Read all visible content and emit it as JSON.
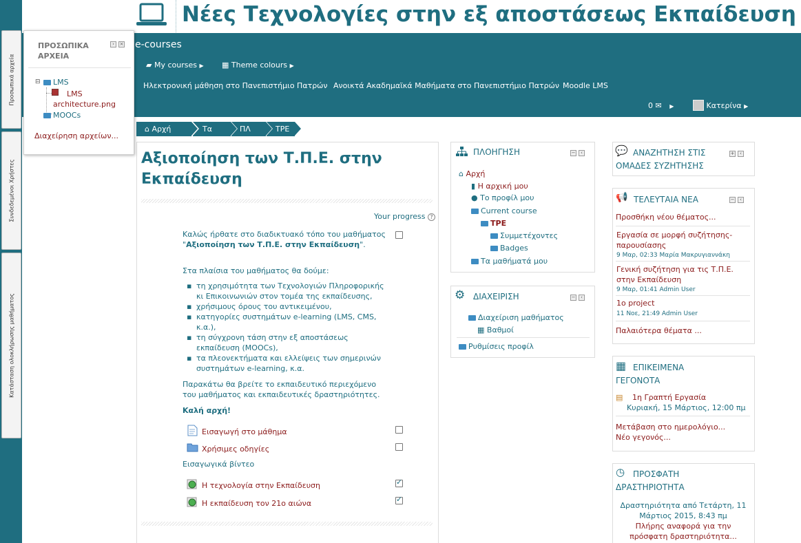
{
  "header": {
    "title": "Νέες Τεχνολογίες στην εξ αποστάσεως Εκπαίδευση",
    "brand": "e-courses",
    "my_courses": "My courses",
    "theme_colours": "Theme colours",
    "links": [
      "Ηλεκτρονική μάθηση στο Πανεπιστήμιο Πατρών",
      "Ανοικτά Ακαδημαϊκά Μαθήματα στο Πανεπιστήμιο Πατρών",
      "Moodle LMS"
    ],
    "messages_count": "0",
    "user_name": "Κατερίνα"
  },
  "dock": {
    "tabs": [
      "Προσωπικά αρχεία",
      "Συνδεδεμένοι Χρήστες",
      "Κατάσταση ολοκλήρωσης μαθήματος"
    ]
  },
  "private_files": {
    "title": "ΠΡΟΣΩΠΙΚΑ ΑΡΧΕΙΑ",
    "folder1": "LMS",
    "file1": "LMS architecture.png",
    "folder2": "MOOCs",
    "manage": "Διαχείρηση αρχείων..."
  },
  "breadcrumb": [
    "Αρχή",
    "Τα",
    "ΠΛ",
    "ΤΡΕ"
  ],
  "course": {
    "title": "Αξιοποίηση των Τ.Π.Ε. στην Εκπαίδευση",
    "your_progress": "Your progress",
    "intro_1": "Καλώς ήρθατε στο διαδικτυακό τόπο του μαθήματος \"",
    "intro_bold": "Αξιοποίηση των Τ.Π.Ε. στην Εκπαίδευση",
    "intro_2": "\".",
    "intro_list_title": "Στα πλαίσια του μαθήματος θα δούμε:",
    "topics": [
      "τη χρησιμότητα των Τεχνολογιών Πληροφορικής κι Επικοινωνιών στον τομέα της εκπαίδευσης,",
      "χρήσιμους όρους του αντικειμένου,",
      "κατηγορίες συστημάτων e-learning (LMS, CMS, κ.α.),",
      "τη σύγχρονη τάση στην εξ αποστάσεως εκπαίδευση (MOOCs),",
      "τα πλεονεκτήματα και ελλείψεις των σημερινών συστημάτων e-learning, κ.α."
    ],
    "outro": "Παρακάτω θα βρείτε το εκπαιδευτικό περιεχόμενο του μαθήματος και εκπαιδευτικές δραστηριότητες.",
    "good_start": "Καλή αρχή!",
    "activities": [
      {
        "label": "Εισαγωγή στο μάθημα",
        "done": false
      },
      {
        "label": "Χρήσιμες οδηγίες",
        "done": false
      }
    ],
    "videos_label": "Εισαγωγικά βίντεο",
    "videos": [
      {
        "label": "Η τεχνολογία στην Εκπαίδευση",
        "done": true
      },
      {
        "label": "Η εκπαίδευση τον 21ο αιώνα",
        "done": true
      }
    ]
  },
  "navigation": {
    "title": "ΠΛΟΗΓΗΣΗ",
    "home": "Αρχή",
    "my_home": "Η αρχική μου",
    "profile": "Το προφίλ μου",
    "current_course": "Current course",
    "tpe": "TPE",
    "participants": "Συμμετέχοντες",
    "badges": "Badges",
    "my_courses": "Τα μαθήματά μου"
  },
  "admin": {
    "title": "ΔΙΑΧΕΙΡΙΣΗ",
    "course_admin": "Διαχείριση μαθήματος",
    "grades": "Βαθμοί",
    "profile_settings": "Ρυθμίσεις προφίλ"
  },
  "forum_search": {
    "title": "ΑΝΑΖΗΤΗΣΗ ΣΤΙΣ ΟΜΑΔΕΣ ΣΥΖΗΤΗΣΗΣ"
  },
  "news": {
    "title": "ΤΕΛΕΥΤΑΙΑ ΝΕΑ",
    "add_topic": "Προσθήκη νέου θέματος...",
    "items": [
      {
        "title": "Εργασία σε μορφή συζήτησης-παρουσίασης",
        "meta": "9 Μαρ, 02:33 Μαρία Μακρυγιαννάκη"
      },
      {
        "title": "Γενική συζήτηση για τις Τ.Π.Ε. στην Εκπαίδευση",
        "meta": "9 Μαρ, 01:41 Admin User"
      },
      {
        "title": "1o project",
        "meta": "11 Νοε, 21:49 Admin User"
      }
    ],
    "older": "Παλαιότερα θέματα ..."
  },
  "events": {
    "title": "ΕΠΙΚΕΙΜΕΝΑ ΓΕΓΟΝΟΤΑ",
    "event_title": "1η Γραπτή Εργασία",
    "event_date": "Κυριακή, 15 Μάρτιος, 12:00 πμ",
    "go_calendar": "Μετάβαση στο ημερολόγιο...",
    "new_event": "Νέο γεγονός..."
  },
  "recent": {
    "title": "ΠΡΟΣΦΑΤΗ ΔΡΑΣΤΗΡΙΟΤΗΤΑ",
    "since": "Δραστηριότητα από Τετάρτη, 11 Μάρτιος 2015, 8:43 πμ",
    "full_report": "Πλήρης αναφορά για την πρόσφατη δραστηριότητα..."
  },
  "colors": {
    "primary": "#1f6e80",
    "link": "#8b1a1a"
  }
}
